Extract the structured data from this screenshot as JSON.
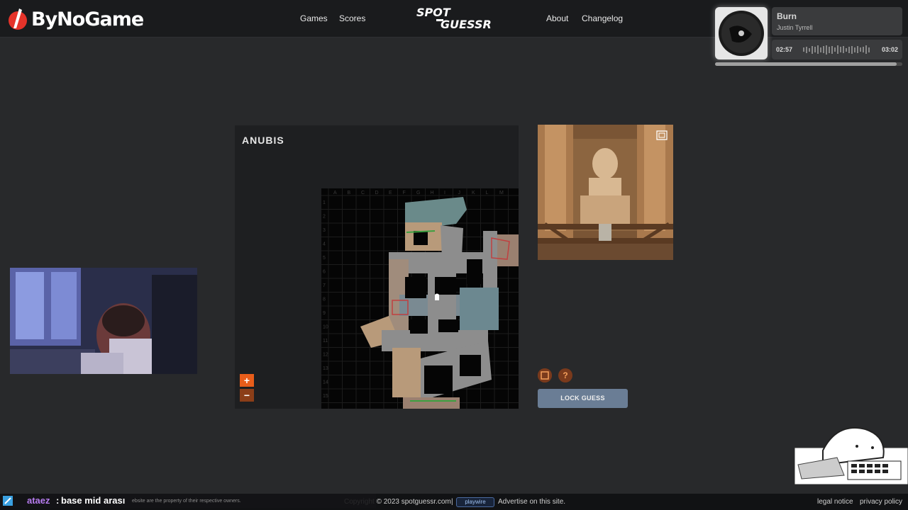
{
  "header": {
    "brand": "ByNoGame",
    "nav_left": [
      "Games",
      "Scores"
    ],
    "logo_line1": "SPOT",
    "logo_line2": "GUESSR",
    "nav_right": [
      "About",
      "Changelog"
    ]
  },
  "music": {
    "title": "Burn",
    "artist": "Justin Tyrrell",
    "current_time": "02:57",
    "total_time": "03:02",
    "progress": 0.97
  },
  "game": {
    "map_name": "ANUBIS",
    "zoom_in": "+",
    "zoom_out": "−",
    "help_icon": "?",
    "lock_guess": "LOCK GUESS",
    "grid_cols": [
      "A",
      "B",
      "C",
      "D",
      "E",
      "F",
      "G",
      "H",
      "I",
      "J",
      "K",
      "L",
      "M"
    ],
    "grid_rows": [
      "1",
      "2",
      "3",
      "4",
      "5",
      "6",
      "7",
      "8",
      "9",
      "10",
      "11",
      "12",
      "13",
      "14",
      "15"
    ]
  },
  "chat": {
    "user": "ataez",
    "separator": ":",
    "message": "base mid arası",
    "disclaimer": "ebsite are the property of their respective owners."
  },
  "footer": {
    "copyright": "Copyright © 2023 spotguessr.com",
    "separator": "|",
    "playwire": "playwire",
    "advertise": "Advertise on this site.",
    "legal": "legal notice",
    "privacy": "privacy policy"
  },
  "colors": {
    "accent_orange": "#e85d1a",
    "lock_button": "#6a7d95",
    "background": "#28292b"
  }
}
